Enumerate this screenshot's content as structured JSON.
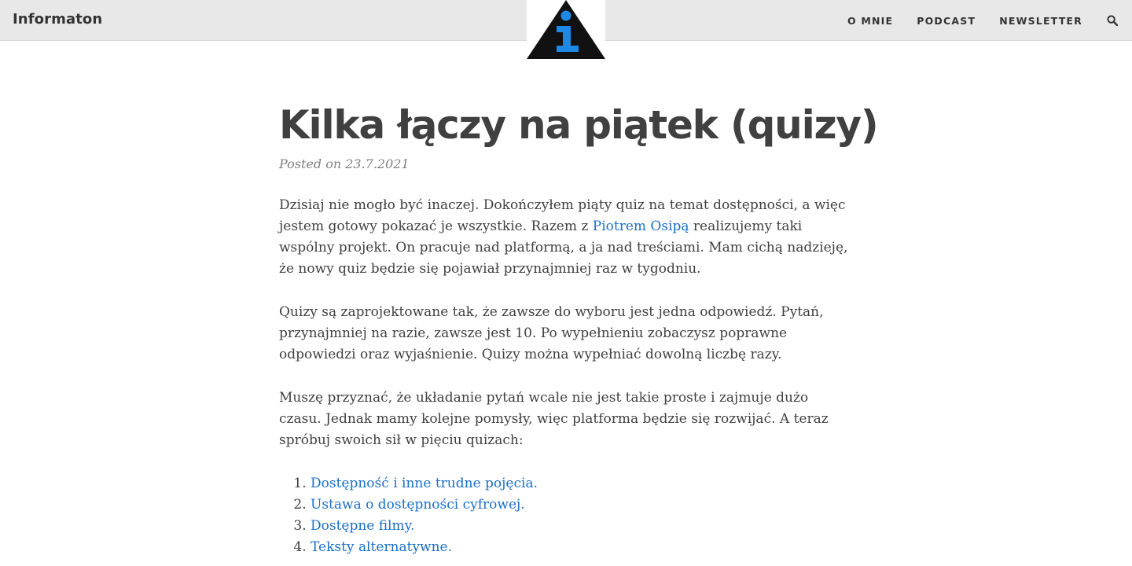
{
  "header": {
    "site_title": "Informaton",
    "nav": [
      {
        "label": "O MNIE"
      },
      {
        "label": "PODCAST"
      },
      {
        "label": "NEWSLETTER"
      }
    ],
    "search_icon": "search-icon",
    "logo_icon": "info-triangle-logo",
    "colors": {
      "header_bg": "#e8e8e8",
      "logo_dark": "#111111",
      "logo_accent": "#1e88e5"
    }
  },
  "post": {
    "title": "Kilka łączy na piątek (quizy)",
    "meta": "Posted on 23.7.2021",
    "p1": {
      "before": "Dzisiaj nie mogło być inaczej. Dokończyłem piąty quiz na temat dostępności, a więc jestem gotowy pokazać je wszystkie. Razem z ",
      "link": "Piotrem Osipą",
      "after": " realizujemy taki wspólny projekt. On pracuje nad platformą, a ja nad treściami. Mam cichą nadzieję, że nowy quiz będzie się pojawiał przynajmniej raz w tygodniu."
    },
    "p2": "Quizy są zaprojektowane tak, że zawsze do wyboru jest jedna odpowiedź. Pytań, przynajmniej na razie, zawsze jest 10. Po wypełnieniu zobaczysz poprawne odpowiedzi oraz wyjaśnienie. Quizy można wypełniać dowolną liczbę razy.",
    "p3": "Muszę przyznać, że układanie pytań wcale nie jest takie proste i zajmuje dużo czasu. Jednak mamy kolejne pomysły, więc platforma będzie się rozwijać. A teraz spróbuj swoich sił w pięciu quizach:",
    "quizzes": [
      "Dostępność i inne trudne pojęcia.",
      "Ustawa o dostępności cyfrowej.",
      "Dostępne filmy.",
      "Teksty alternatywne."
    ],
    "link_color": "#1a6fc9"
  }
}
